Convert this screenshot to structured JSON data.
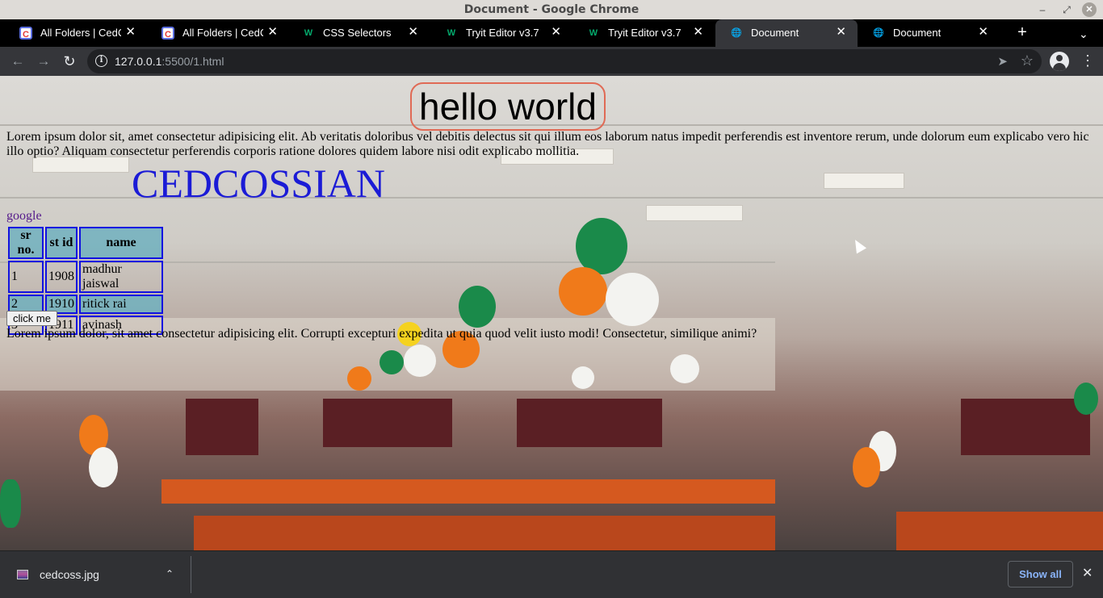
{
  "window": {
    "title": "Document - Google Chrome"
  },
  "tabs": [
    {
      "label": "All Folders | CedCommerce",
      "icon": "cedcommerce-icon",
      "active": false
    },
    {
      "label": "All Folders | CedCommerce",
      "icon": "cedcommerce-icon",
      "active": false
    },
    {
      "label": "CSS Selectors",
      "icon": "w3schools-icon",
      "active": false
    },
    {
      "label": "Tryit Editor v3.7",
      "icon": "w3schools-icon",
      "active": false
    },
    {
      "label": "Tryit Editor v3.7",
      "icon": "w3schools-icon",
      "active": false
    },
    {
      "label": "Document",
      "icon": "globe-icon",
      "active": true
    },
    {
      "label": "Document",
      "icon": "globe-icon",
      "active": false
    }
  ],
  "toolbar": {
    "url_host": "127.0.0.1",
    "url_path": ":5500/1.html"
  },
  "page": {
    "heading": "hello world",
    "paragraph1": "Lorem ipsum dolor sit, amet consectetur adipisicing elit. Ab veritatis doloribus vel debitis delectus sit qui illum eos laborum natus impedit perferendis est inventore rerum, unde dolorum eum explicabo vero hic illo optio? Aliquam consectetur perferendis corporis ratione dolores quidem labore nisi odit explicabo mollitia.",
    "brand": "CEDCOSSIAN",
    "link": "google",
    "table": {
      "headers": [
        "sr no.",
        "st id",
        "name"
      ],
      "rows": [
        [
          "1",
          "1908",
          "madhur jaiswal"
        ],
        [
          "2",
          "1910",
          "ritick rai"
        ],
        [
          "3",
          "1911",
          "avinash"
        ]
      ]
    },
    "button": "click me",
    "paragraph2": "Lorem ipsum dolor, sit amet consectetur adipisicing elit. Corrupti excepturi expedita ut quia quod velit iusto modi! Consectetur, similique animi?"
  },
  "downloads": {
    "file": "cedcoss.jpg",
    "show_all": "Show all"
  },
  "colors": {
    "heading_border": "#e06a55",
    "brand": "#1b1bd6",
    "table_border": "#1212e0",
    "table_fill": "#6db0be",
    "show_all": "#8ab4f8"
  }
}
